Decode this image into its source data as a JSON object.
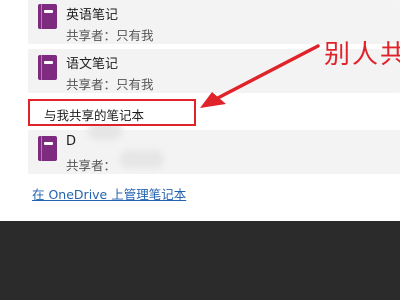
{
  "notebooks": [
    {
      "title": "英语笔记",
      "sharer": "共享者：只有我"
    },
    {
      "title": "语文笔记",
      "sharer": "共享者：只有我"
    }
  ],
  "shared_section": {
    "label": "与我共享的笔记本",
    "items": [
      {
        "title": "D",
        "sharer": "共享者："
      }
    ]
  },
  "manage_link": "在 OneDrive 上管理笔记本",
  "annotation": {
    "text": "别人共",
    "color": "#e0232a"
  },
  "colors": {
    "notebook_icon": "#7d2a7f",
    "link": "#2463b0",
    "highlight": "#e0232a"
  }
}
